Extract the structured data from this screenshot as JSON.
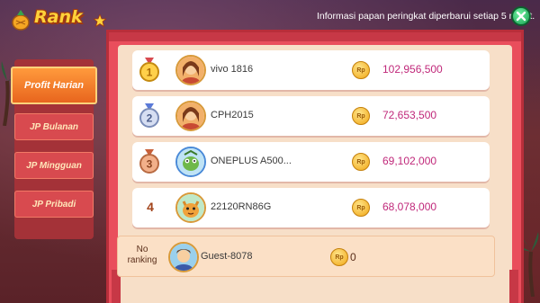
{
  "header": {
    "title": "Rank",
    "notice": "Informasi papan peringkat diperbarui setiap 5 menit."
  },
  "tabs": [
    {
      "label": "Profit Harian",
      "active": true
    },
    {
      "label": "JP Bulanan",
      "active": false
    },
    {
      "label": "JP Mingguan",
      "active": false
    },
    {
      "label": "JP Pribadi",
      "active": false
    }
  ],
  "ranking": [
    {
      "rank": "1",
      "badge": "gold-medal",
      "name": "vivo 1816",
      "score": "102,956,500"
    },
    {
      "rank": "2",
      "badge": "silver-medal",
      "name": "CPH2015",
      "score": "72,653,500"
    },
    {
      "rank": "3",
      "badge": "bronze-medal",
      "name": "ONEPLUS A500...",
      "score": "69,102,000"
    },
    {
      "rank": "4",
      "badge": "none",
      "name": "22120RN86G",
      "score": "68,078,000"
    }
  ],
  "coin_label": "Rp",
  "me": {
    "rank_text": "No ranking",
    "name": "Guest-8078",
    "score": "0"
  },
  "colors": {
    "accent_orange": "#e8651e",
    "score_magenta": "#c0287a",
    "board_red": "#e94e5c",
    "panel_cream": "#f7dfc8"
  }
}
